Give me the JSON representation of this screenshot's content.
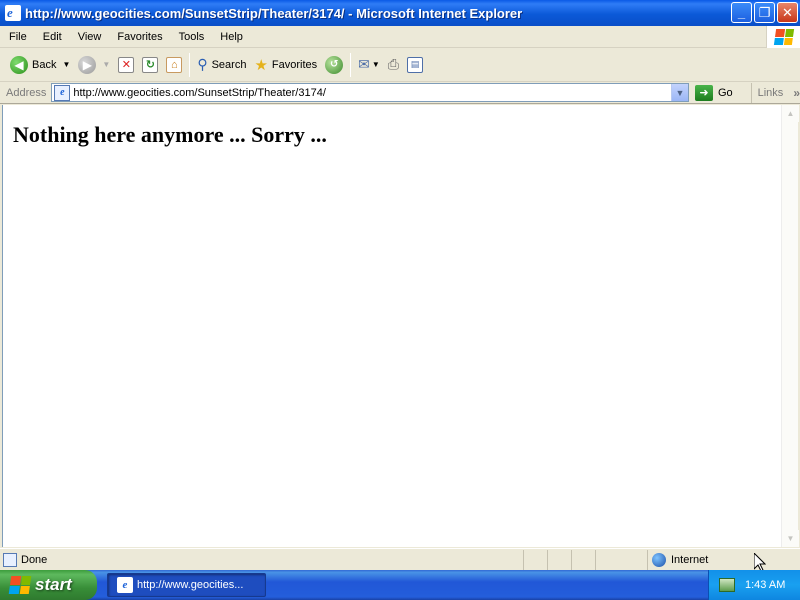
{
  "window": {
    "title": "http://www.geocities.com/SunsetStrip/Theater/3174/ - Microsoft Internet Explorer",
    "minimize_glyph": "_",
    "restore_glyph": "❐",
    "close_glyph": "✕"
  },
  "menu": {
    "items": [
      "File",
      "Edit",
      "View",
      "Favorites",
      "Tools",
      "Help"
    ]
  },
  "toolbar": {
    "back_label": "Back",
    "search_label": "Search",
    "favorites_label": "Favorites"
  },
  "address": {
    "label": "Address",
    "url": "http://www.geocities.com/SunsetStrip/Theater/3174/",
    "go_label": "Go",
    "links_label": "Links"
  },
  "page": {
    "heading": "Nothing here anymore ... Sorry ..."
  },
  "status": {
    "text": "Done",
    "zone": "Internet"
  },
  "taskbar": {
    "start_label": "start",
    "task_label": "http://www.geocities...",
    "clock": "1:43 AM"
  },
  "colors": {
    "titlebar": "#0b59d8",
    "taskbar": "#245edb",
    "start_button": "#388e38",
    "chrome": "#ece9d8"
  }
}
